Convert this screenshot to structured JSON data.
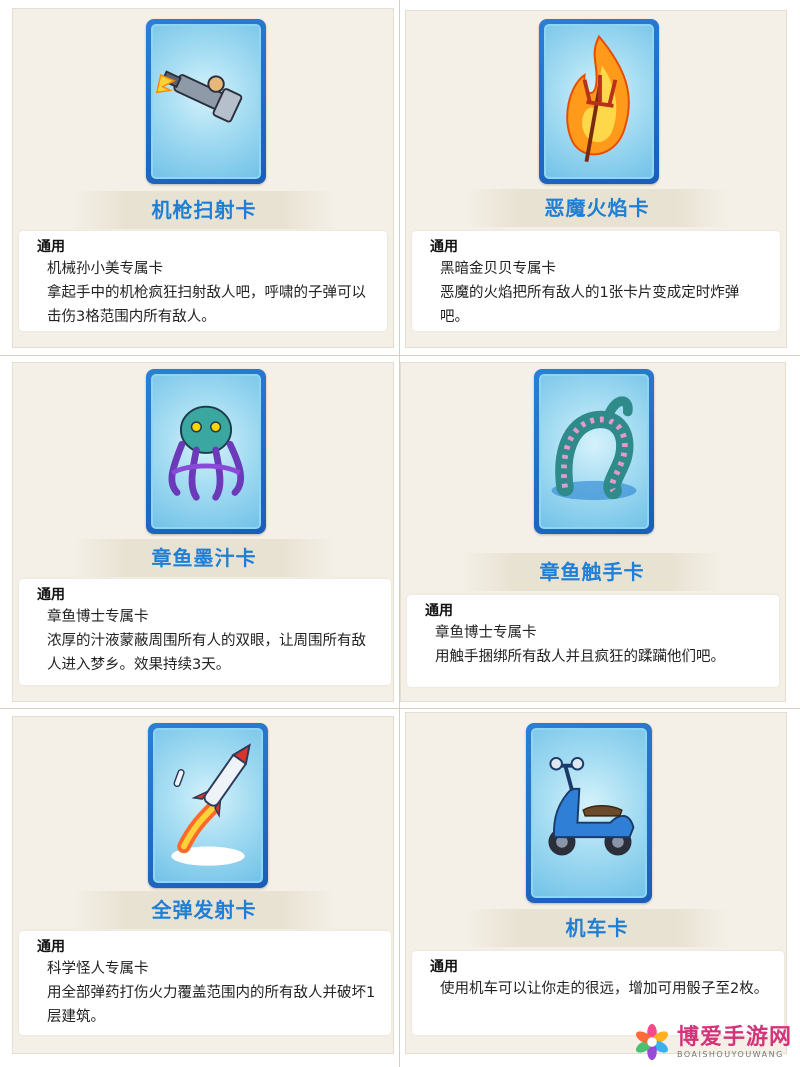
{
  "cards": [
    {
      "name": "机枪扫射卡",
      "tag": "通用",
      "owner": "机械孙小美专属卡",
      "description": "拿起手中的机枪疯狂扫射敌人吧，呼啸的子弹可以击伤3格范围内所有敌人。",
      "icon": "machine-gun-icon"
    },
    {
      "name": "恶魔火焰卡",
      "tag": "通用",
      "owner": "黑暗金贝贝专属卡",
      "description": "恶魔的火焰把所有敌人的1张卡片变成定时炸弹吧。",
      "icon": "flaming-trident-icon"
    },
    {
      "name": "章鱼墨汁卡",
      "tag": "通用",
      "owner": "章鱼博士专属卡",
      "description": "浓厚的汁液蒙蔽周围所有人的双眼，让周围所有敌人进入梦乡。效果持续3天。",
      "icon": "octopus-icon"
    },
    {
      "name": "章鱼触手卡",
      "tag": "通用",
      "owner": "章鱼博士专属卡",
      "description": "用触手捆绑所有敌人并且疯狂的蹂躏他们吧。",
      "icon": "tentacle-icon"
    },
    {
      "name": "全弹发射卡",
      "tag": "通用",
      "owner": "科学怪人专属卡",
      "description": "用全部弹药打伤火力覆盖范围内的所有敌人并破坏1层建筑。",
      "icon": "missile-icon"
    },
    {
      "name": "机车卡",
      "tag": "通用",
      "owner": "",
      "description": "使用机车可以让你走的很远，增加可用骰子至2枚。",
      "icon": "scooter-icon"
    }
  ],
  "watermark": {
    "title": "博爱手游网",
    "subtitle": "BOAISHOUYOUWANG"
  },
  "colors": {
    "title_blue": "#1f7fd6",
    "card_frame": "#1a5db8",
    "panel_bg": "#f4f0e7",
    "watermark_pink": "#d4337a"
  }
}
